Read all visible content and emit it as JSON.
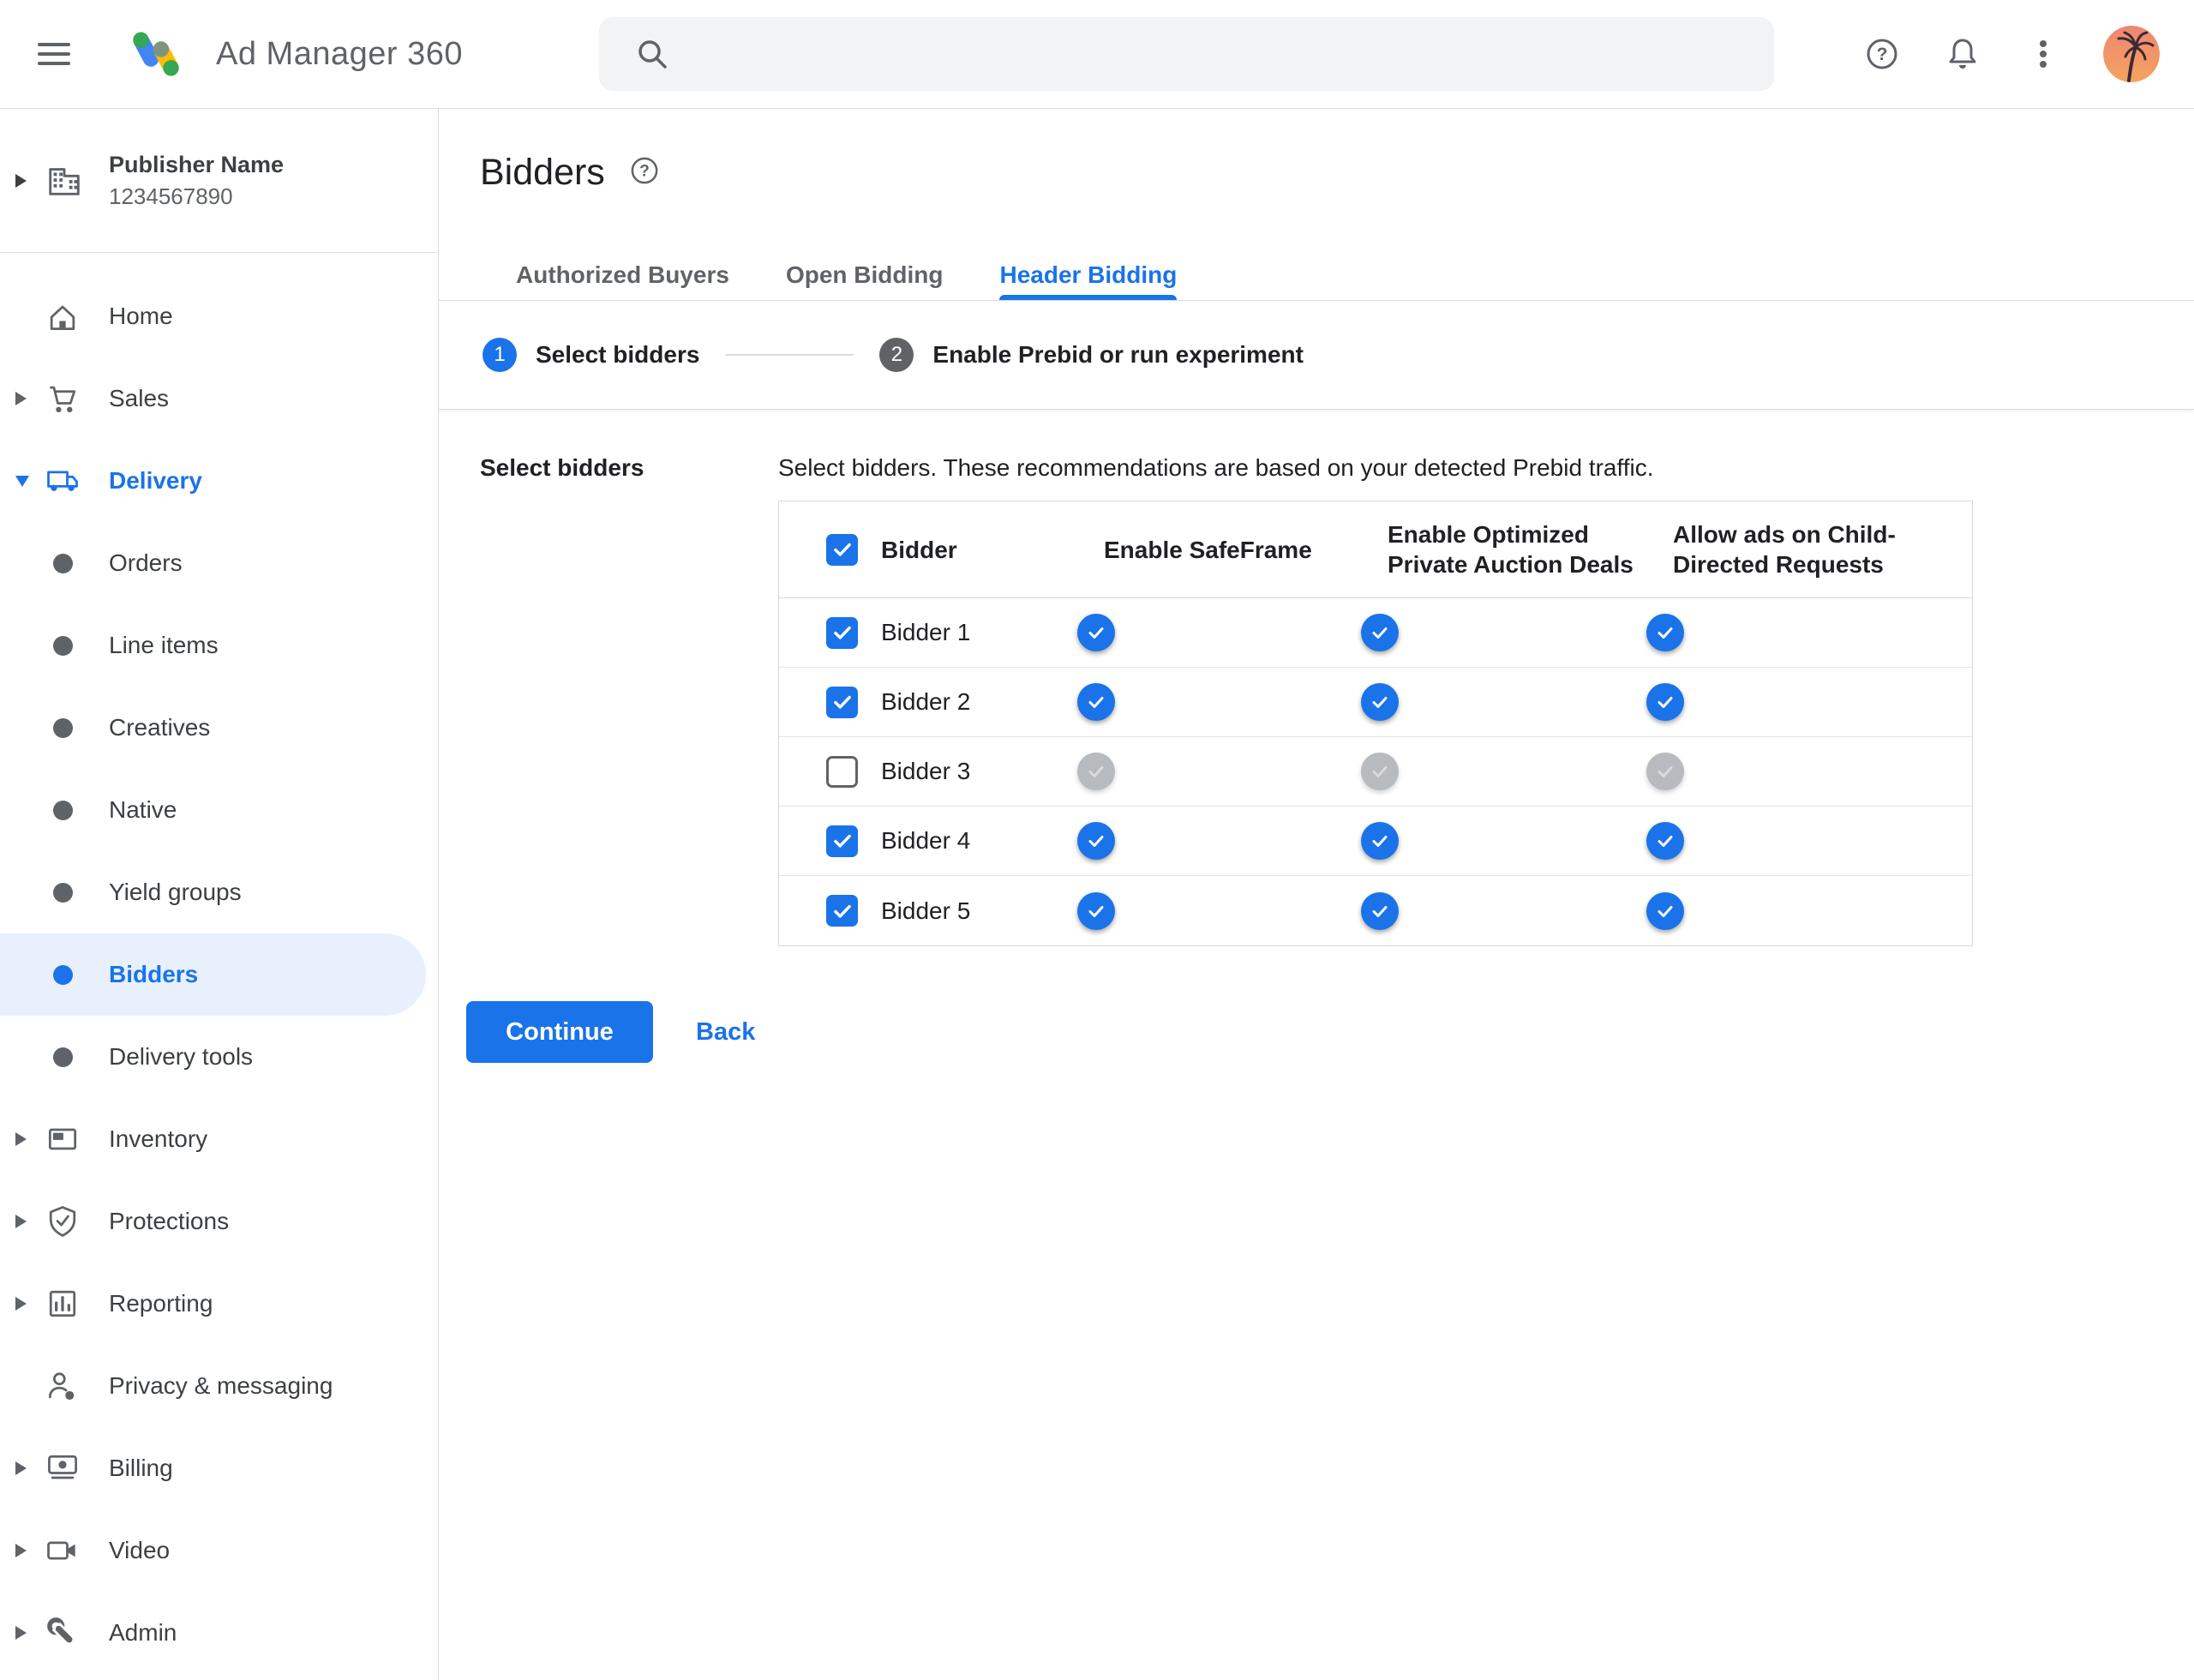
{
  "topbar": {
    "app_name": "Ad Manager 360",
    "search_placeholder": ""
  },
  "sidebar": {
    "publisher": {
      "name": "Publisher Name",
      "id": "1234567890"
    },
    "items": [
      {
        "label": "Home",
        "icon": "home-icon",
        "level": "top",
        "chevron": "none",
        "selected": false
      },
      {
        "label": "Sales",
        "icon": "cart-icon",
        "level": "top",
        "chevron": "right",
        "selected": false
      },
      {
        "label": "Delivery",
        "icon": "truck-icon",
        "level": "top",
        "chevron": "down",
        "expanded": true,
        "selected": false
      },
      {
        "label": "Orders",
        "icon": "bullet",
        "level": "sub",
        "selected": false
      },
      {
        "label": "Line items",
        "icon": "bullet",
        "level": "sub",
        "selected": false
      },
      {
        "label": "Creatives",
        "icon": "bullet",
        "level": "sub",
        "selected": false
      },
      {
        "label": "Native",
        "icon": "bullet",
        "level": "sub",
        "selected": false
      },
      {
        "label": "Yield groups",
        "icon": "bullet",
        "level": "sub",
        "selected": false
      },
      {
        "label": "Bidders",
        "icon": "bullet",
        "level": "sub",
        "selected": true
      },
      {
        "label": "Delivery tools",
        "icon": "bullet",
        "level": "sub",
        "selected": false
      },
      {
        "label": "Inventory",
        "icon": "window-icon",
        "level": "top",
        "chevron": "right",
        "selected": false
      },
      {
        "label": "Protections",
        "icon": "shield-icon",
        "level": "top",
        "chevron": "right",
        "selected": false
      },
      {
        "label": "Reporting",
        "icon": "chart-icon",
        "level": "top",
        "chevron": "right",
        "selected": false
      },
      {
        "label": "Privacy & messaging",
        "icon": "person-icon",
        "level": "top",
        "chevron": "none",
        "selected": false
      },
      {
        "label": "Billing",
        "icon": "payments-icon",
        "level": "top",
        "chevron": "right",
        "selected": false
      },
      {
        "label": "Video",
        "icon": "videocam-icon",
        "level": "top",
        "chevron": "right",
        "selected": false
      },
      {
        "label": "Admin",
        "icon": "wrench-icon",
        "level": "top",
        "chevron": "right",
        "selected": false
      }
    ]
  },
  "main": {
    "title": "Bidders",
    "tabs": [
      {
        "label": "Authorized Buyers",
        "active": false
      },
      {
        "label": "Open Bidding",
        "active": false
      },
      {
        "label": "Header Bidding",
        "active": true
      }
    ],
    "stepper": [
      {
        "number": "1",
        "label": "Select bidders",
        "active": true
      },
      {
        "number": "2",
        "label": "Enable Prebid or run experiment",
        "active": false
      }
    ],
    "section_label": "Select bidders",
    "description": "Select bidders. These recommendations are based on your detected Prebid traffic.",
    "table": {
      "header_checkbox_checked": true,
      "columns": [
        "Bidder",
        "Enable SafeFrame",
        "Enable Optimized Private Auction Deals",
        "Allow ads on Child-Directed Requests"
      ],
      "rows": [
        {
          "name": "Bidder 1",
          "selected": true,
          "enable_safeframe": true,
          "enable_optimized_private_auction_deals": true,
          "allow_ads_child_directed": true
        },
        {
          "name": "Bidder 2",
          "selected": true,
          "enable_safeframe": true,
          "enable_optimized_private_auction_deals": true,
          "allow_ads_child_directed": true
        },
        {
          "name": "Bidder 3",
          "selected": false,
          "enable_safeframe": false,
          "enable_optimized_private_auction_deals": false,
          "allow_ads_child_directed": false
        },
        {
          "name": "Bidder 4",
          "selected": true,
          "enable_safeframe": true,
          "enable_optimized_private_auction_deals": true,
          "allow_ads_child_directed": true
        },
        {
          "name": "Bidder 5",
          "selected": true,
          "enable_safeframe": true,
          "enable_optimized_private_auction_deals": true,
          "allow_ads_child_directed": true
        }
      ]
    },
    "actions": {
      "continue_label": "Continue",
      "back_label": "Back"
    }
  },
  "colors": {
    "accent": "#1a73e8",
    "toggle_track_on": "#9dc0f9",
    "toggle_track_off": "#e8eaed",
    "toggle_thumb_off": "#b7babe",
    "selected_pill": "#e8f0fe",
    "divider": "#dadce0",
    "text_primary": "#202124",
    "text_secondary": "#5f6368"
  }
}
